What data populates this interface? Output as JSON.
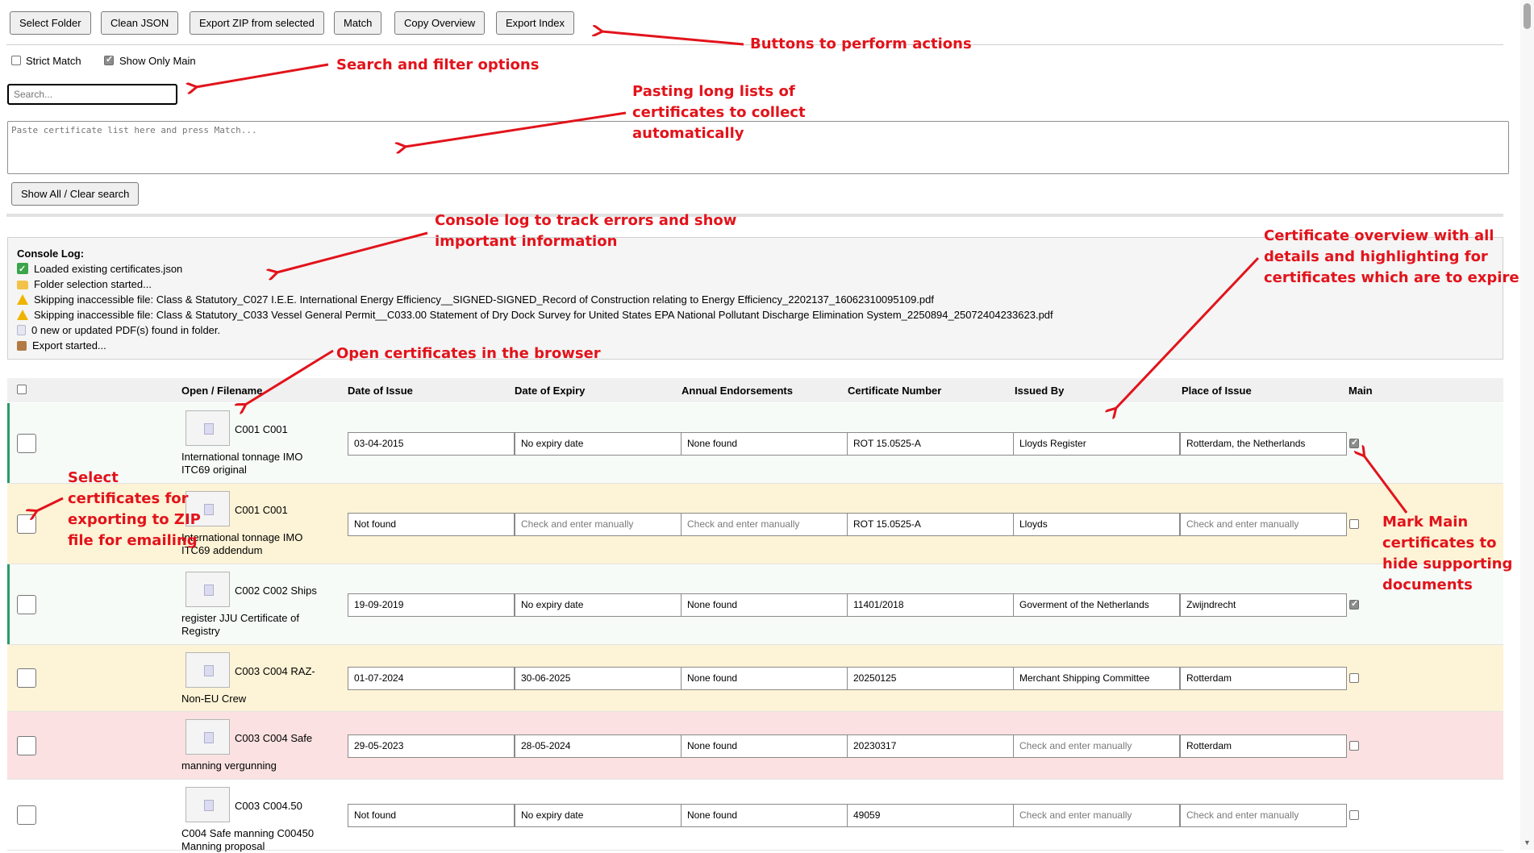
{
  "toolbar": {
    "select_folder": "Select Folder",
    "clean_json": "Clean JSON",
    "export_zip": "Export ZIP from selected",
    "match": "Match",
    "copy_overview": "Copy Overview",
    "export_index": "Export Index"
  },
  "filters": {
    "strict_match": "Strict Match",
    "strict_match_checked": false,
    "show_only_main": "Show Only Main",
    "show_only_main_checked": true
  },
  "search": {
    "placeholder": "Search..."
  },
  "paste": {
    "placeholder": "Paste certificate list here and press Match..."
  },
  "show_all_button": "Show All / Clear search",
  "console": {
    "title": "Console Log:",
    "lines": [
      {
        "icon": "check-icon",
        "text": "Loaded existing certificates.json"
      },
      {
        "icon": "folder-icon",
        "text": "Folder selection started..."
      },
      {
        "icon": "warning-icon",
        "text": "Skipping inaccessible file: Class & Statutory_C027 I.E.E. International Energy Efficiency__SIGNED-SIGNED_Record of Construction relating to Energy Efficiency_2202137_16062310095109.pdf"
      },
      {
        "icon": "warning-icon",
        "text": "Skipping inaccessible file: Class & Statutory_C033 Vessel General Permit__C033.00 Statement of Dry Dock Survey for United States EPA National Pollutant Discharge Elimination System_2250894_25072404233623.pdf"
      },
      {
        "icon": "document-icon",
        "text": "0 new or updated PDF(s) found in folder."
      },
      {
        "icon": "package-icon",
        "text": "Export started..."
      }
    ]
  },
  "table": {
    "headers": {
      "open": "Open / Filename",
      "issue": "Date of Issue",
      "expiry": "Date of Expiry",
      "annual": "Annual Endorsements",
      "number": "Certificate Number",
      "issued_by": "Issued By",
      "place": "Place of Issue",
      "main": "Main"
    },
    "rows": [
      {
        "status": "main",
        "name_top": "C001 C001",
        "name_rest": "International tonnage IMO ITC69 original",
        "issue": "03-04-2015",
        "expiry": "No expiry date",
        "annual": "None found",
        "number": "ROT 15.0525-A",
        "issued_by": "Lloyds Register",
        "place": "Rotterdam, the Netherlands",
        "main": true
      },
      {
        "status": "warning",
        "name_top": "C001 C001",
        "name_rest": "International tonnage IMO ITC69 addendum",
        "issue": "Not found",
        "expiry": "Check and enter manually",
        "annual": "Check and enter manually",
        "number": "ROT 15.0525-A",
        "issued_by": "Lloyds",
        "place": "Check and enter manually",
        "main": false
      },
      {
        "status": "main",
        "name_top": "C002 C002 Ships",
        "name_rest": "register JJU Certificate of Registry",
        "issue": "19-09-2019",
        "expiry": "No expiry date",
        "annual": "None found",
        "number": "11401/2018",
        "issued_by": "Goverment of the Netherlands",
        "place": "Zwijndrecht",
        "main": true
      },
      {
        "status": "warning",
        "name_top": "C003 C004 RAZ-",
        "name_rest": "Non-EU Crew",
        "issue": "01-07-2024",
        "expiry": "30-06-2025",
        "annual": "None found",
        "number": "20250125",
        "issued_by": "Merchant Shipping Committee",
        "place": "Rotterdam",
        "main": false
      },
      {
        "status": "expired",
        "name_top": "C003 C004 Safe",
        "name_rest": "manning vergunning",
        "issue": "29-05-2023",
        "expiry": "28-05-2024",
        "annual": "None found",
        "number": "20230317",
        "issued_by": "Check and enter manually",
        "place": "Rotterdam",
        "main": false
      },
      {
        "status": "none",
        "name_top": "C003 C004.50",
        "name_rest": "C004 Safe manning C00450 Manning proposal",
        "issue": "Not found",
        "expiry": "No expiry date",
        "annual": "None found",
        "number": "49059",
        "issued_by": "Check and enter manually",
        "place": "Check and enter manually",
        "main": false
      }
    ]
  },
  "annotations": {
    "buttons": "Buttons to perform actions",
    "search": "Search and filter options",
    "paste_1": "Pasting long lists of",
    "paste_2": "certificates to collect",
    "paste_3": "automatically",
    "console_1": "Console log to track errors and show",
    "console_2": "important information",
    "open_cert": "Open certificates in the browser",
    "overview_1": "Certificate overview with all",
    "overview_2": "details and highlighting for",
    "overview_3": "certificates which are to expire",
    "select_1": "Select",
    "select_2": "certificates for",
    "select_3": "exporting to ZIP",
    "select_4": "file for emailing",
    "main_1": "Mark Main",
    "main_2": "certificates to",
    "main_3": "hide supporting",
    "main_4": "documents"
  },
  "colors": {
    "annotation": "#e2131b",
    "main_row_bg": "#f6fbf8",
    "main_row_border": "#2a9a6a",
    "warning_row_bg": "#fdf3d6",
    "expired_row_bg": "#fbe1e1"
  }
}
